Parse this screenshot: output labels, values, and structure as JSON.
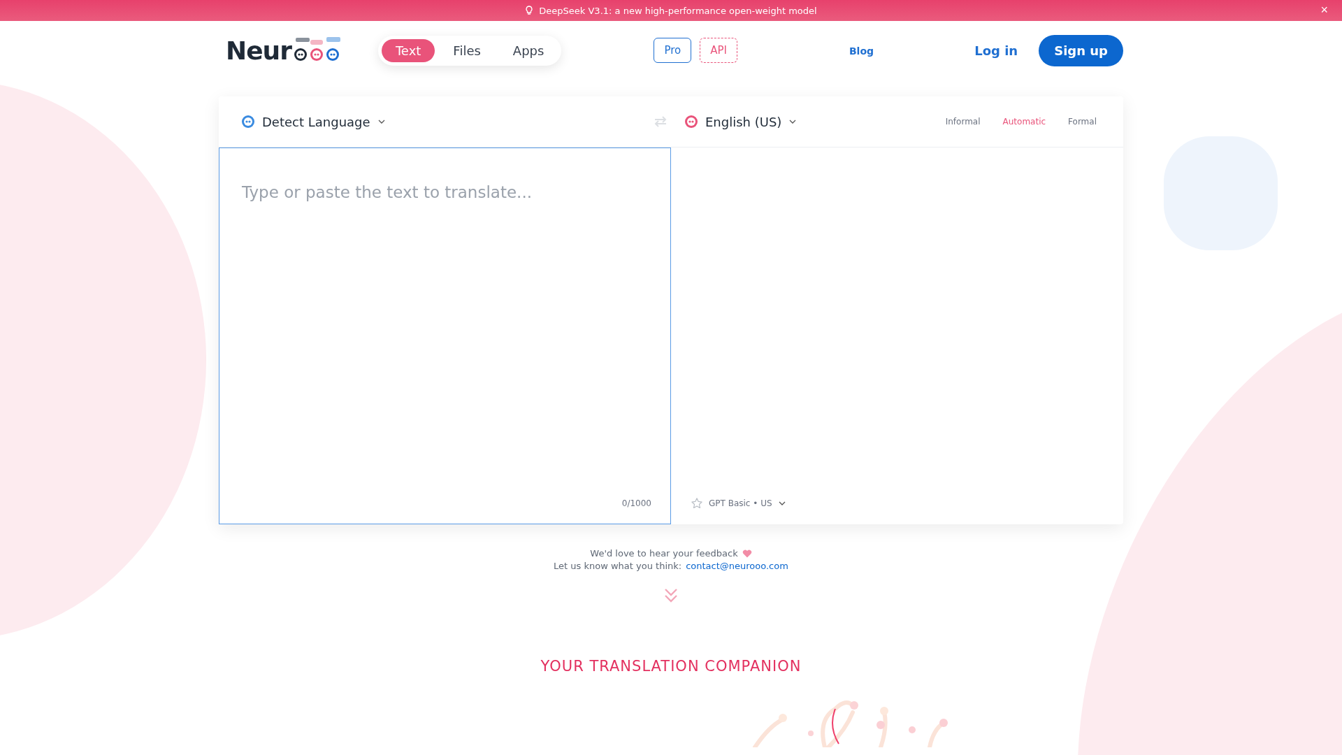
{
  "banner": {
    "text": "DeepSeek V3.1: a new high-performance open-weight model",
    "close_label": "×"
  },
  "logo": {
    "text": "Neur"
  },
  "mode_tabs": [
    {
      "label": "Text",
      "selected": true
    },
    {
      "label": "Files",
      "selected": false
    },
    {
      "label": "Apps",
      "selected": false
    }
  ],
  "plan_buttons": [
    {
      "label": "Pro",
      "kind": "solid"
    },
    {
      "label": "API",
      "kind": "dashed"
    }
  ],
  "nav_links": [
    {
      "label": "Blog"
    }
  ],
  "auth": {
    "login": "Log in",
    "signup": "Sign up"
  },
  "translator": {
    "source_language": "Detect Language",
    "target_language": "English (US)",
    "formality": [
      {
        "label": "Informal",
        "selected": false
      },
      {
        "label": "Automatic",
        "selected": true
      },
      {
        "label": "Formal",
        "selected": false
      }
    ],
    "input": {
      "placeholder": "Type or paste the text to translate...",
      "focused": true
    },
    "counter": "0/1000",
    "model": "GPT Basic • US"
  },
  "feedback": {
    "line_1": "We'd love to hear your feedback",
    "line_2": "Let us know what you think:",
    "email": "contact@neurooo.com"
  },
  "section_heading": "YOUR TRANSLATION COMPANION"
}
